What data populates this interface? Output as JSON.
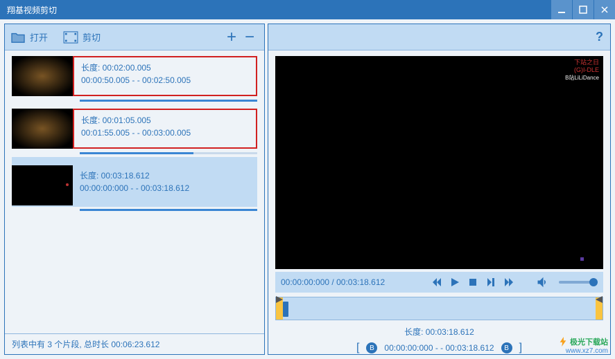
{
  "window": {
    "title": "翔基视频剪切"
  },
  "toolbar": {
    "open_label": "打开",
    "cut_label": "剪切"
  },
  "clips": [
    {
      "duration_label": "长度: 00:02:00.005",
      "range_label": "00:00:50.005  - -  00:02:50.005",
      "progress_pct": 100,
      "highlighted": true,
      "thumb": "glow"
    },
    {
      "duration_label": "长度: 00:01:05.005",
      "range_label": "00:01:55.005  - -  00:03:00.005",
      "progress_pct": 64,
      "highlighted": true,
      "thumb": "glow"
    },
    {
      "duration_label": "长度: 00:03:18.612",
      "range_label": "00:00:00:000  - -  00:03:18.612",
      "progress_pct": 100,
      "selected": true,
      "thumb": "dark"
    }
  ],
  "footer": {
    "status": "列表中有 3 个片段, 总时长 00:06:23.612"
  },
  "player": {
    "current_time": "00:00:00:000",
    "total_time": "00:03:18.612",
    "duration_line": "长度: 00:03:18.612",
    "range_line": "00:00:00:000  - -  00:03:18.612",
    "watermark_line1": "下站之日",
    "watermark_line2": "(G)I-DLE",
    "watermark_line3": "B站LiLiDance"
  },
  "site": {
    "name": "极光下载站",
    "url": "www.xz7.com"
  }
}
